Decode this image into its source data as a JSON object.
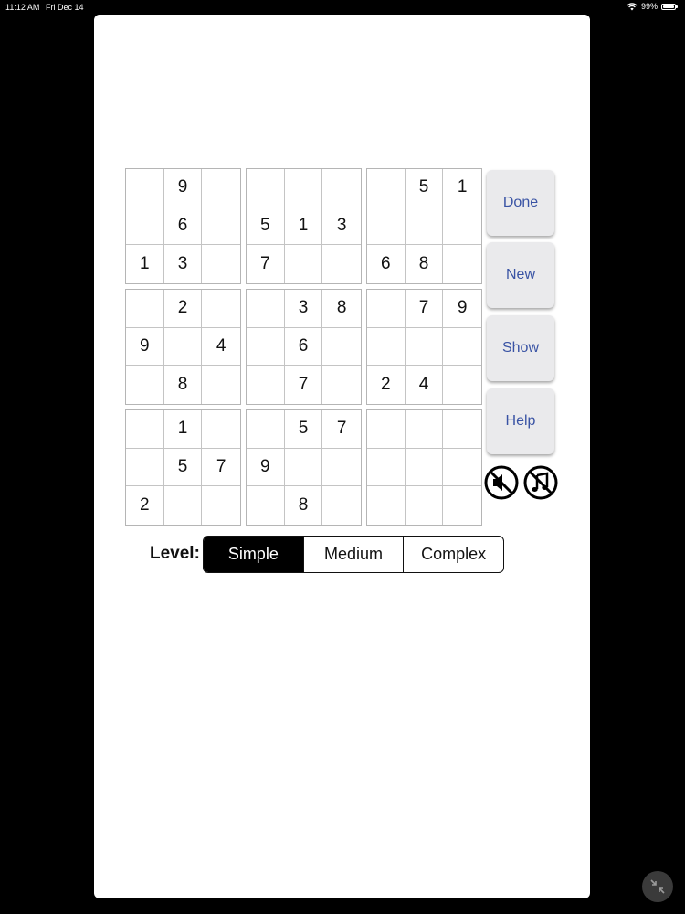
{
  "status_bar": {
    "time": "11:12 AM",
    "date": "Fri Dec 14",
    "battery": "99%",
    "battery_level": 0.99,
    "icons": [
      "wifi-icon",
      "battery-icon"
    ]
  },
  "board": {
    "rows": [
      [
        "",
        "9",
        "",
        "",
        "",
        "",
        "",
        "5",
        "1"
      ],
      [
        "",
        "6",
        "",
        "5",
        "1",
        "3",
        "",
        "",
        ""
      ],
      [
        "1",
        "3",
        "",
        "7",
        "",
        "",
        "6",
        "8",
        ""
      ],
      [
        "",
        "2",
        "",
        "",
        "3",
        "8",
        "",
        "7",
        "9"
      ],
      [
        "9",
        "",
        "4",
        "",
        "6",
        "",
        "",
        "",
        ""
      ],
      [
        "",
        "8",
        "",
        "",
        "7",
        "",
        "2",
        "4",
        ""
      ],
      [
        "",
        "1",
        "",
        "",
        "5",
        "7",
        "",
        "",
        ""
      ],
      [
        "",
        "5",
        "7",
        "9",
        "",
        "",
        "",
        "",
        ""
      ],
      [
        "2",
        "",
        "",
        "",
        "8",
        "",
        "",
        "",
        ""
      ]
    ]
  },
  "side_buttons": {
    "done": "Done",
    "new": "New",
    "show": "Show",
    "help": "Help"
  },
  "sound_controls": {
    "icons": [
      "sound-muted-icon",
      "music-off-icon"
    ]
  },
  "level": {
    "label": "Level:",
    "options": [
      "Simple",
      "Medium",
      "Complex"
    ],
    "selected": "Simple"
  },
  "colors": {
    "button_text": "#3953a4",
    "button_bg": "#eaeaec",
    "selected_segment": "#000000"
  }
}
